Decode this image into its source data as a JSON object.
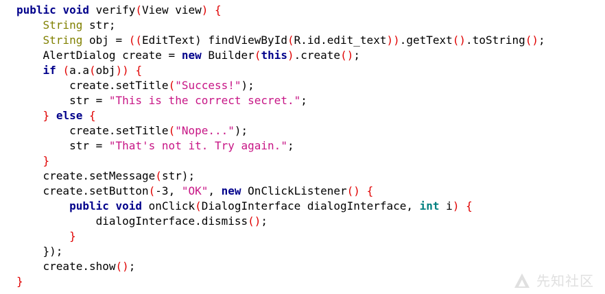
{
  "code": {
    "l1": [
      "public",
      "void",
      "verify",
      "(",
      "View view",
      ")",
      "{"
    ],
    "l2": [
      "String",
      "str;"
    ],
    "l3": [
      "String",
      "obj = ",
      "((",
      "EditText",
      ") findViewById",
      "(",
      "R.id.edit_text",
      "))",
      ".getText",
      "()",
      ".toString",
      "()",
      ";"
    ],
    "l4": [
      "AlertDialog create = ",
      "new",
      "Builder",
      "(",
      "this",
      ")",
      ".create",
      "()",
      ";"
    ],
    "l5": [
      "if",
      "(",
      "a.a",
      "(",
      "obj",
      "))",
      "{"
    ],
    "l6": [
      "create.setTitle",
      "(",
      "\"Success!\"",
      ");"
    ],
    "l7": [
      "str = ",
      "\"This is the correct secret.\"",
      ";"
    ],
    "l8": [
      "}",
      "else",
      "{"
    ],
    "l9": [
      "create.setTitle",
      "(",
      "\"Nope...\"",
      ");"
    ],
    "l10": [
      "str = ",
      "\"That's not it. Try again.\"",
      ";"
    ],
    "l11": [
      "}"
    ],
    "l12": [
      "create.setMessage",
      "(",
      "str",
      ");"
    ],
    "l13": [
      "create.setButton",
      "(",
      "-3, ",
      "\"OK\"",
      ", ",
      "new",
      "OnClickListener",
      "()",
      "{"
    ],
    "l14": [
      "public",
      "void",
      "onClick",
      "(",
      "DialogInterface dialogInterface, ",
      "int",
      " i",
      ")",
      "{"
    ],
    "l15": [
      "dialogInterface.dismiss",
      "()",
      ";"
    ],
    "l16": [
      "}"
    ],
    "l17": [
      "})",
      ";"
    ],
    "l18": [
      "create.show",
      "()",
      ";"
    ],
    "l19": [
      "}"
    ]
  },
  "watermark": {
    "text": "先知社区",
    "icon": "watermark-logo-icon"
  }
}
